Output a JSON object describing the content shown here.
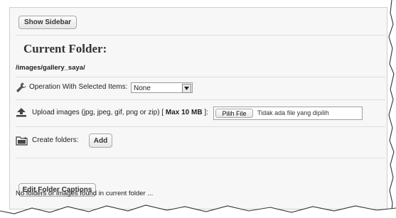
{
  "toolbar": {
    "show_sidebar_label": "Show Sidebar"
  },
  "header": {
    "title": "Current Folder:",
    "path": "/images/gallery_saya/"
  },
  "operation": {
    "label": "Operation With Selected Items:",
    "selected": "None",
    "icon": "wrench-icon"
  },
  "upload": {
    "label_prefix": "Upload images (jpg, jpeg, gif, png or zip) [ ",
    "max_size": "Max 10 MB",
    "label_suffix": " ]:",
    "choose_file_label": "Pilih File",
    "no_file_text": "Tidak ada file yang dipilih",
    "icon": "upload-icon"
  },
  "create": {
    "label": "Create folders:",
    "add_label": "Add",
    "icon": "folder-icon"
  },
  "captions": {
    "edit_label": "Edit Folder Captions"
  },
  "status": {
    "message": "No folders or images found in current folder ..."
  }
}
